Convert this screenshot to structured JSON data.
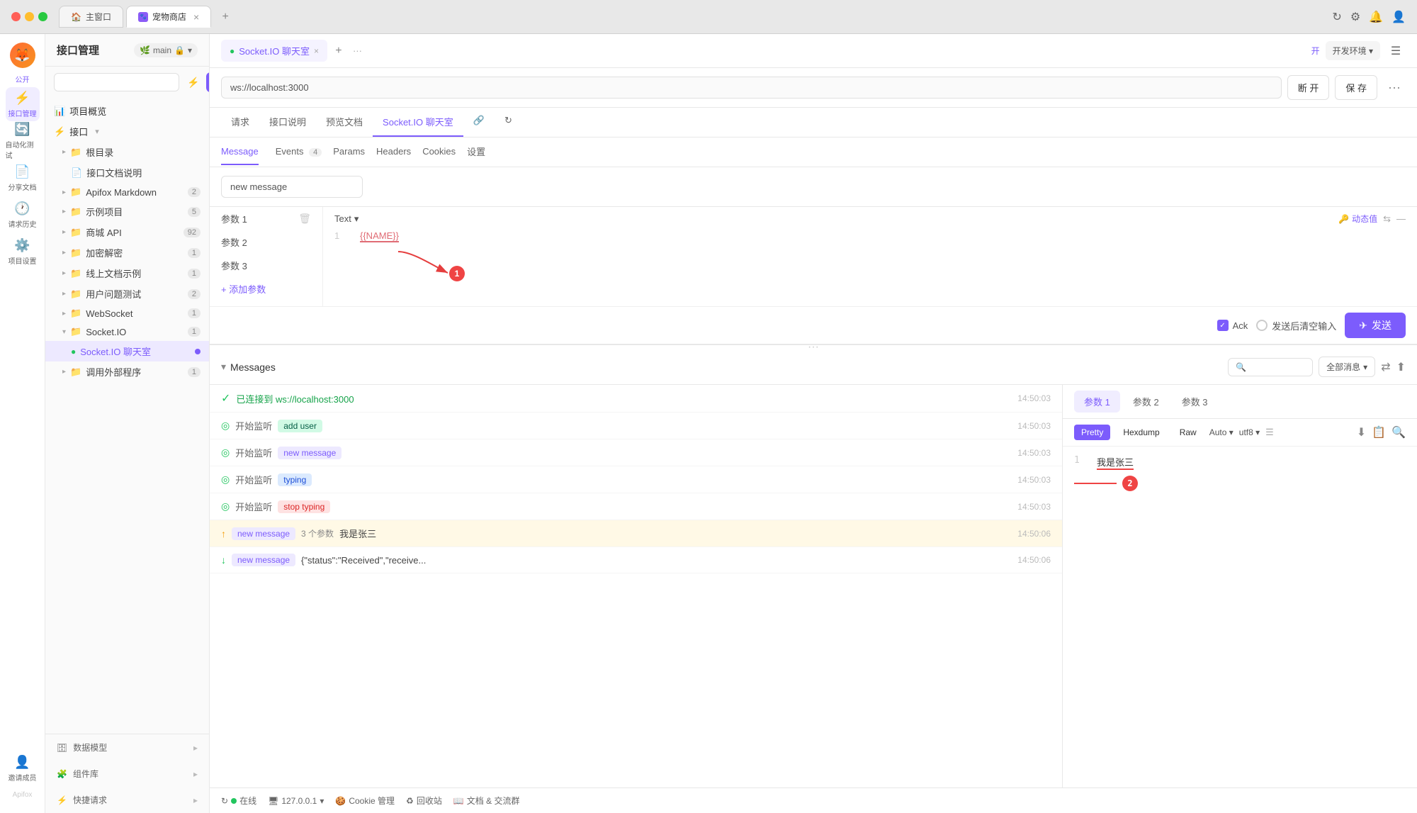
{
  "browser": {
    "tabs": [
      {
        "id": "home",
        "label": "主窗口",
        "icon": "🏠",
        "active": false
      },
      {
        "id": "pet",
        "label": "宠物商店",
        "icon": "🐾",
        "active": true
      }
    ],
    "add_tab": "+",
    "more": "···"
  },
  "icon_sidebar": {
    "items": [
      {
        "id": "home",
        "icon": "🏠",
        "label": ""
      },
      {
        "id": "api-management",
        "icon": "⚡",
        "label": "接口管理",
        "active": true
      },
      {
        "id": "automation",
        "icon": "🔄",
        "label": "自动化测试"
      },
      {
        "id": "docs",
        "icon": "📄",
        "label": "分享文档"
      },
      {
        "id": "history",
        "icon": "🕐",
        "label": "请求历史"
      },
      {
        "id": "settings",
        "icon": "⚙️",
        "label": "项目设置"
      }
    ],
    "user_avatar": "👤",
    "invite": "邀请成员"
  },
  "nav_panel": {
    "title": "接口管理",
    "branch": "main",
    "search_placeholder": "",
    "tree": [
      {
        "id": "overview",
        "label": "项目概览",
        "indent": 0,
        "icon": "📊"
      },
      {
        "id": "api",
        "label": "接口",
        "indent": 0,
        "icon": "⚡",
        "expandable": true
      },
      {
        "id": "root",
        "label": "根目录",
        "indent": 1,
        "icon": "📁"
      },
      {
        "id": "api-docs",
        "label": "接口文档说明",
        "indent": 2,
        "icon": "📄"
      },
      {
        "id": "apifox-markdown",
        "label": "Apifox Markdown",
        "indent": 1,
        "icon": "📁",
        "badge": "2"
      },
      {
        "id": "examples",
        "label": "示例项目",
        "indent": 1,
        "icon": "📁",
        "badge": "5"
      },
      {
        "id": "shop-api",
        "label": "商城 API",
        "indent": 1,
        "icon": "📁",
        "badge": "92"
      },
      {
        "id": "encrypt",
        "label": "加密解密",
        "indent": 1,
        "icon": "📁",
        "badge": "1"
      },
      {
        "id": "online-docs",
        "label": "线上文档示例",
        "indent": 1,
        "icon": "📁",
        "badge": "1"
      },
      {
        "id": "user-tests",
        "label": "用户问题测试",
        "indent": 1,
        "icon": "📁",
        "badge": "2"
      },
      {
        "id": "websocket",
        "label": "WebSocket",
        "indent": 1,
        "icon": "📁",
        "badge": "1"
      },
      {
        "id": "socketio",
        "label": "Socket.IO",
        "indent": 1,
        "icon": "📁",
        "badge": "1",
        "expanded": true
      },
      {
        "id": "socketio-chat",
        "label": "Socket.IO 聊天室",
        "indent": 2,
        "icon": "●",
        "active": true
      },
      {
        "id": "external",
        "label": "调用外部程序",
        "indent": 1,
        "icon": "📁",
        "badge": "1"
      }
    ],
    "bottom_items": [
      {
        "id": "data-model",
        "label": "数据模型"
      },
      {
        "id": "components",
        "label": "组件库"
      },
      {
        "id": "quick-request",
        "label": "快捷请求"
      }
    ]
  },
  "main": {
    "top_tabs": [
      {
        "id": "socketio-chat",
        "label": "Socket.IO 聊天室",
        "icon": "●",
        "active": true,
        "closable": true
      }
    ],
    "add_tab": "+",
    "more": "···",
    "env": "开发环境",
    "page_title": "Socket.IO 聊天室",
    "url": "ws://localhost:3000",
    "disconnect_btn": "断 开",
    "save_btn": "保 存",
    "sec_tabs": [
      {
        "id": "request",
        "label": "请求",
        "active": false
      },
      {
        "id": "api-doc",
        "label": "接口说明",
        "active": false
      },
      {
        "id": "preview-doc",
        "label": "预览文档",
        "active": false
      },
      {
        "id": "socketio-tab",
        "label": "Socket.IO 聊天室",
        "active": true
      },
      {
        "id": "link-icon",
        "label": "🔗",
        "active": false
      },
      {
        "id": "refresh-icon",
        "label": "↻",
        "active": false
      }
    ],
    "message_tabs": [
      {
        "id": "message",
        "label": "Message",
        "active": true
      },
      {
        "id": "events",
        "label": "Events",
        "badge": "4",
        "active": false
      },
      {
        "id": "params",
        "label": "Params",
        "active": false
      },
      {
        "id": "headers",
        "label": "Headers",
        "active": false
      },
      {
        "id": "cookies",
        "label": "Cookies",
        "active": false
      },
      {
        "id": "settings",
        "label": "设置",
        "active": false
      }
    ],
    "event_name": "new message",
    "params": [
      {
        "id": "param1",
        "label": "参数 1"
      },
      {
        "id": "param2",
        "label": "参数 2"
      },
      {
        "id": "param3",
        "label": "参数 3"
      }
    ],
    "add_param_label": "+ 添加参数",
    "code_type": "Text",
    "code_line1_num": "1",
    "code_line1_content": "{{NAME}}",
    "dynamic_value_label": "动态值",
    "ack_label": "Ack",
    "clear_label": "发送后清空输入",
    "send_label": "发送",
    "annotation1": "1"
  },
  "messages": {
    "title": "Messages",
    "search_placeholder": "",
    "filter_label": "全部消息",
    "items": [
      {
        "id": "m1",
        "direction": "connected",
        "text": "已连接到 ws://localhost:3000",
        "time": "14:50:03",
        "type": "connected"
      },
      {
        "id": "m2",
        "direction": "watch",
        "label": "开始监听",
        "tag": "add user",
        "tag_type": "green",
        "time": "14:50:03"
      },
      {
        "id": "m3",
        "direction": "watch",
        "label": "开始监听",
        "tag": "new message",
        "tag_type": "purple",
        "time": "14:50:03"
      },
      {
        "id": "m4",
        "direction": "watch",
        "label": "开始监听",
        "tag": "typing",
        "tag_type": "blue",
        "time": "14:50:03"
      },
      {
        "id": "m5",
        "direction": "watch",
        "label": "开始监听",
        "tag": "stop typing",
        "tag_type": "red",
        "time": "14:50:03"
      },
      {
        "id": "m6",
        "direction": "up",
        "tag": "new message",
        "tag_type": "purple",
        "params": "3 个参数",
        "text": "我是张三",
        "time": "14:50:06",
        "highlighted": true
      },
      {
        "id": "m7",
        "direction": "down",
        "tag": "new message",
        "tag_type": "purple",
        "text": "{\"status\":\"Received\",\"receive...",
        "time": "14:50:06"
      }
    ],
    "right_tabs": [
      {
        "id": "param1",
        "label": "参数 1",
        "active": true
      },
      {
        "id": "param2",
        "label": "参数 2",
        "active": false
      },
      {
        "id": "param3",
        "label": "参数 3",
        "active": false
      }
    ],
    "right_formats": [
      "Pretty",
      "Hexdump",
      "Raw"
    ],
    "right_active_format": "Pretty",
    "right_encoding": "Auto",
    "right_charset": "utf8",
    "right_content_line1_num": "1",
    "right_content_line1": "我是张三",
    "annotation2": "2"
  },
  "status_bar": {
    "online_label": "在线",
    "ip_label": "127.0.0.1",
    "cookie_label": "Cookie 管理",
    "recycle_label": "回收站",
    "docs_label": "文档 & 交流群"
  }
}
